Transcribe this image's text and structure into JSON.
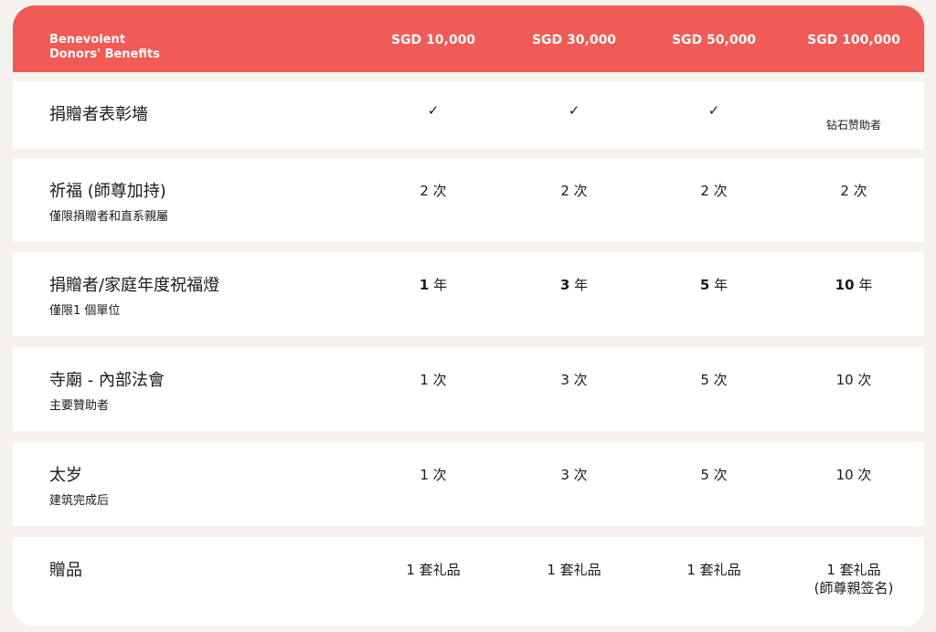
{
  "header": {
    "title_line1": "Benevolent",
    "title_line2": "Donors' Benefits",
    "tiers": [
      "SGD 10,000",
      "SGD 30,000",
      "SGD 50,000",
      "SGD 100,000"
    ]
  },
  "rows": [
    {
      "label": "捐贈者表彰墻",
      "sub": "",
      "cells": [
        "✓",
        "✓",
        "✓",
        "钻石赞助者"
      ]
    },
    {
      "label": "祈福 (師尊加持)",
      "sub": "僅限捐贈者和直系親屬",
      "cells": [
        "2 次",
        "2 次",
        "2 次",
        "2 次"
      ]
    },
    {
      "label": "捐贈者/家庭年度祝福燈",
      "sub": "僅限1 個單位",
      "cells_num": [
        "1",
        "3",
        "5",
        "10"
      ],
      "cells_unit": "年"
    },
    {
      "label": "寺廟 - 內部法會",
      "sub": "主要贊助者",
      "cells": [
        "1 次",
        "3 次",
        "5 次",
        "10 次"
      ]
    },
    {
      "label": "太岁",
      "sub": "建筑完成后",
      "cells": [
        "1 次",
        "3 次",
        "5 次",
        "10 次"
      ]
    },
    {
      "label": "贈品",
      "sub": "",
      "cells": [
        "1 套礼品",
        "1 套礼品",
        "1 套礼品",
        "1 套礼品"
      ],
      "last_note": "(師尊親签名)"
    }
  ]
}
